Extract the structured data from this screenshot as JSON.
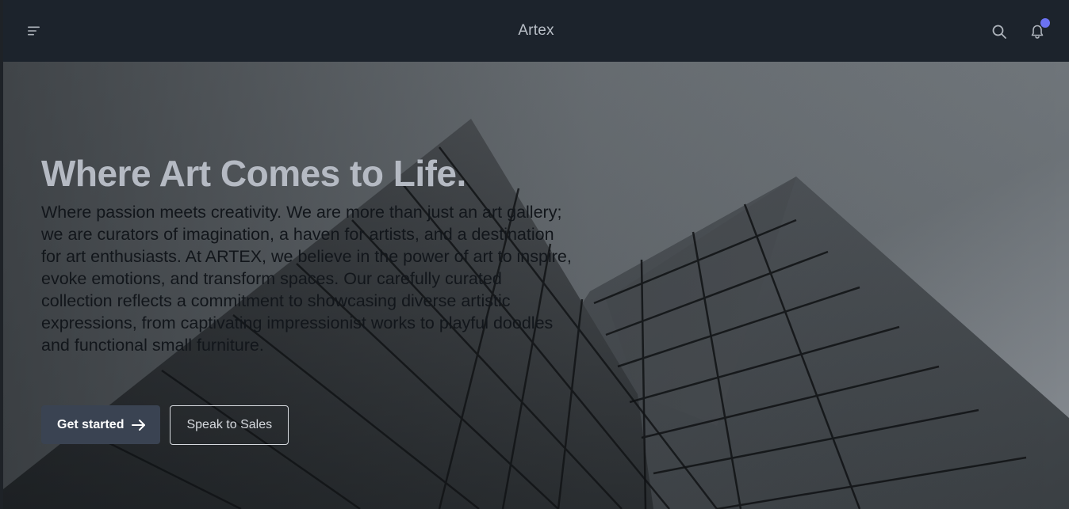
{
  "header": {
    "brand": "Artex",
    "menu_icon": "menu-icon",
    "search_icon": "search-icon",
    "bell_icon": "bell-icon",
    "has_notification": true,
    "notification_color": "#6b72f2"
  },
  "hero": {
    "title": "Where Art Comes to Life.",
    "description": "Where passion meets creativity. We are more than just an art gallery; we are curators of imagination, a haven for artists, and a destination for art enthusiasts. At ARTEX, we believe in the power of art to inspire, evoke emotions, and transform spaces. Our carefully curated collection reflects a commitment to showcasing diverse artistic expressions, from captivating impressionist works to playful doodles and functional small furniture.",
    "primary_cta": "Get started",
    "primary_cta_icon": "arrow-right-icon",
    "secondary_cta": "Speak to Sales",
    "background_image": "grayscale architecture photo"
  },
  "colors": {
    "topbar_bg": "#1c232c",
    "primary_button_bg": "#3a4352",
    "title_color": "#b5bac3"
  }
}
